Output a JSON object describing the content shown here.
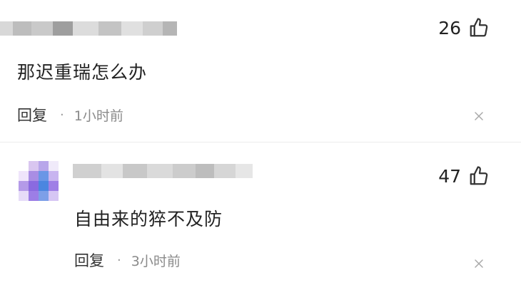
{
  "comments": [
    {
      "likes": "26",
      "text": "那迟重瑞怎么办",
      "reply_label": "回复",
      "separator": "·",
      "time": "1小时前"
    },
    {
      "likes": "47",
      "text": "自由来的猝不及防",
      "reply_label": "回复",
      "separator": "·",
      "time": "3小时前"
    }
  ],
  "icons": {
    "like": "thumbs-up-icon",
    "close": "close-icon"
  },
  "colors": {
    "text": "#222222",
    "meta": "#8a8a8a",
    "icon": "#333333"
  }
}
